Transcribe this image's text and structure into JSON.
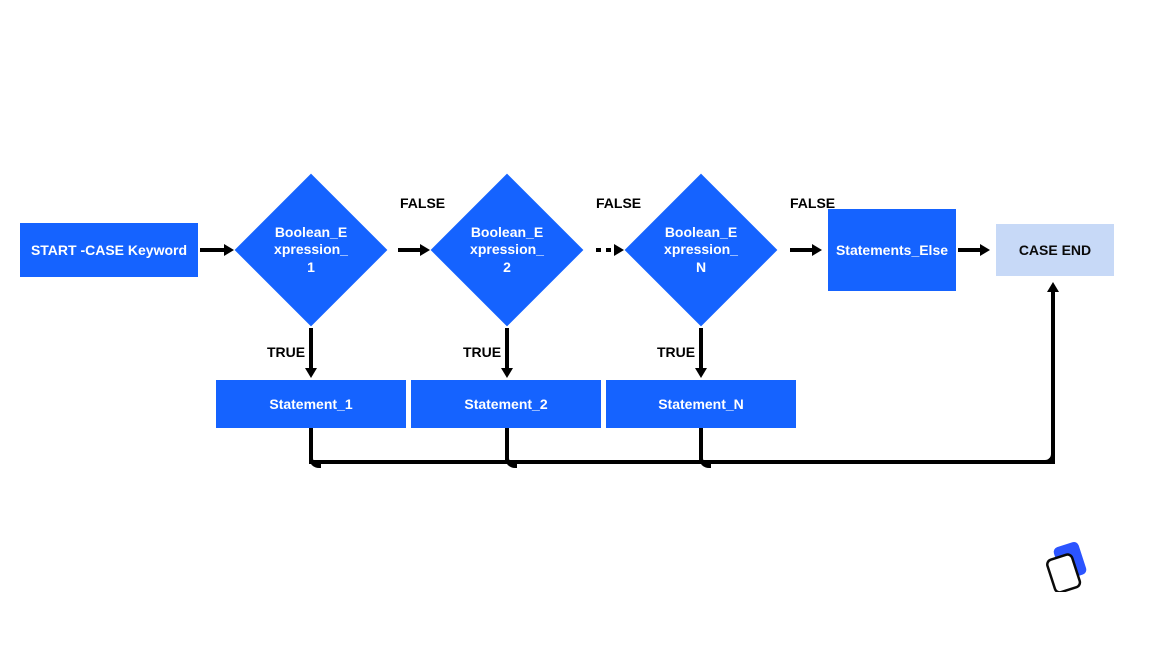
{
  "diagram": {
    "start": "START -CASE Keyword",
    "end": "CASE END",
    "false_label": "FALSE",
    "true_label": "TRUE",
    "decisions": [
      {
        "label": "Boolean_Expression_1"
      },
      {
        "label": "Boolean_Expression_2"
      },
      {
        "label": "Boolean_Expression_N"
      }
    ],
    "statements": [
      "Statement_1",
      "Statement_2",
      "Statement_N"
    ],
    "else_stmt": "Statements_Else"
  },
  "colors": {
    "primary": "#1563ff",
    "end_bg": "#c7d9f7"
  }
}
